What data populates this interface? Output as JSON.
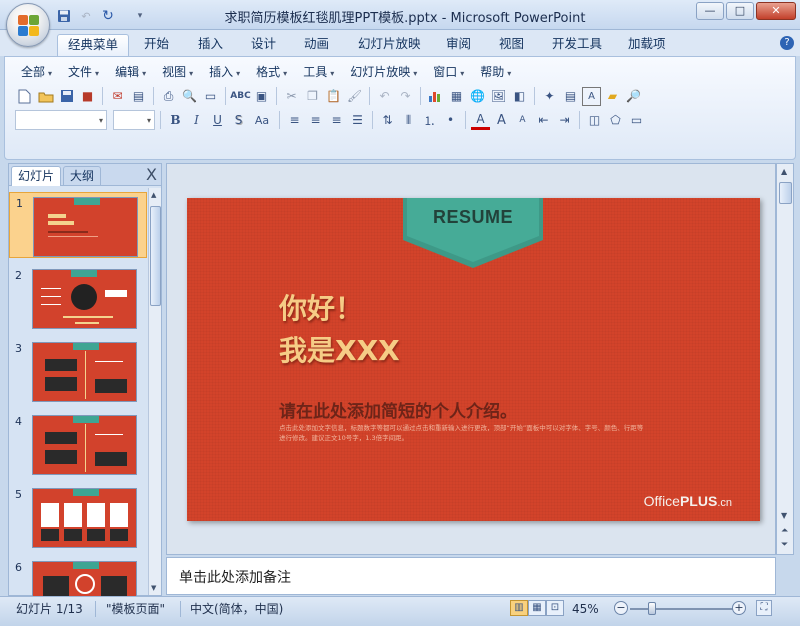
{
  "window": {
    "title": "求职简历模板红毯肌理PPT模板.pptx - Microsoft PowerPoint",
    "controls": {
      "minimize": "—",
      "maximize": "□",
      "close": "✕"
    }
  },
  "quick_access": [
    "save-icon",
    "undo-icon",
    "redo-icon",
    "customize-icon"
  ],
  "ribbon_tabs": [
    {
      "label": "经典菜单",
      "active": true
    },
    {
      "label": "开始"
    },
    {
      "label": "插入"
    },
    {
      "label": "设计"
    },
    {
      "label": "动画"
    },
    {
      "label": "幻灯片放映"
    },
    {
      "label": "审阅"
    },
    {
      "label": "视图"
    },
    {
      "label": "开发工具"
    },
    {
      "label": "加载项"
    }
  ],
  "classic_menu": [
    "全部",
    "文件",
    "编辑",
    "视图",
    "插入",
    "格式",
    "工具",
    "幻灯片放映",
    "窗口",
    "帮助"
  ],
  "format_buttons": {
    "bold": "B",
    "italic": "I",
    "underline": "U",
    "shadow": "S",
    "change_case": "Aa",
    "font_color": "A"
  },
  "side_panel": {
    "tabs": [
      "幻灯片",
      "大纲"
    ],
    "close_label": "X",
    "thumbnail_numbers": [
      "1",
      "2",
      "3",
      "4",
      "5",
      "6"
    ],
    "selected_slide": 1
  },
  "slide": {
    "ribbon_label": "RESUME",
    "greeting_line1": "你好！",
    "greeting_line2": "我是XXX",
    "intro_heading": "请在此处添加简短的个人介绍。",
    "intro_body": "点击此处添加文字信息，标题数字等都可以通过点击和重新输入进行更改，顶部“开始”面板中可以对字体、字号、颜色、行距等进行修改。建议正文10号字，1.3倍字间距。",
    "brand_office": "Office",
    "brand_plus": "PLUS",
    "brand_cn": ".cn"
  },
  "notes": {
    "placeholder": "单击此处添加备注"
  },
  "status_bar": {
    "slide_indicator": "幻灯片 1/13",
    "theme": "\"模板页面\"",
    "language": "中文(简体，中国)",
    "zoom": "45%",
    "zoom_out": "−",
    "zoom_in": "+"
  },
  "colors": {
    "slide_background": "#d3432a",
    "ribbon_teal": "#3ea593",
    "greeting_gold": "#f6cc86",
    "selection_orange": "#fbd28d"
  }
}
